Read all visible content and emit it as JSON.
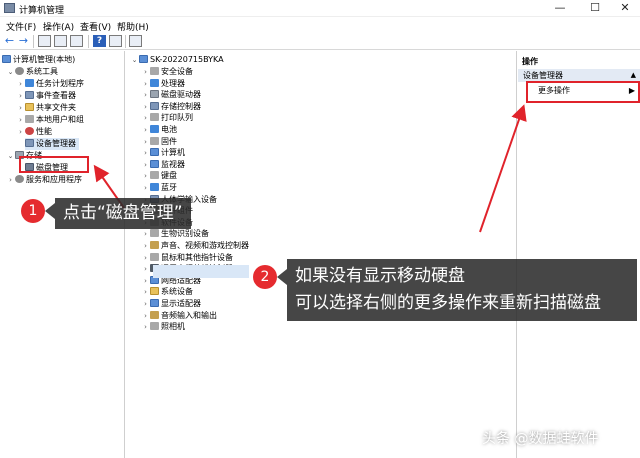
{
  "window": {
    "title": "计算机管理",
    "min_glyph": "—",
    "max_glyph": "☐",
    "close_glyph": "✕"
  },
  "menu": [
    "文件(F)",
    "操作(A)",
    "查看(V)",
    "帮助(H)"
  ],
  "toolbar": {
    "back_glyph": "←",
    "forward_glyph": "→",
    "help_glyph": "?"
  },
  "left_tree": {
    "root": "计算机管理(本地)",
    "system_tools": "系统工具",
    "task_scheduler": "任务计划程序",
    "event_viewer": "事件查看器",
    "shared_folders": "共享文件夹",
    "local_users": "本地用户和组",
    "performance": "性能",
    "device_manager": "设备管理器",
    "storage": "存储",
    "disk_management": "磁盘管理",
    "services": "服务和应用程序"
  },
  "device_tree": {
    "root": "SK-20220715BYKA",
    "items": [
      "安全设备",
      "处理器",
      "磁盘驱动器",
      "存储控制器",
      "打印队列",
      "电池",
      "固件",
      "计算机",
      "监视器",
      "键盘",
      "蓝牙",
      "人体学输入设备",
      "软件组件",
      "软件设备",
      "生物识别设备",
      "声音、视频和游戏控制器",
      "鼠标和其他指针设备",
      "通用串行总线控制器",
      "网络适配器",
      "系统设备",
      "显示适配器",
      "音频输入和输出",
      "照相机"
    ]
  },
  "actions": {
    "header": "操作",
    "section": "设备管理器",
    "more": "更多操作"
  },
  "annotations": {
    "one": {
      "number": "1",
      "text": "点击“磁盘管理”"
    },
    "two": {
      "number": "2",
      "line1": "如果没有显示移动硬盘",
      "line2": "可以选择右侧的更多操作来重新扫描磁盘"
    }
  },
  "watermark": "头条 @数据蛙软件",
  "colors": {
    "annotation_red": "#e0232b",
    "callout_bg": "#2c2c2c",
    "selection": "#d9e7f7"
  }
}
